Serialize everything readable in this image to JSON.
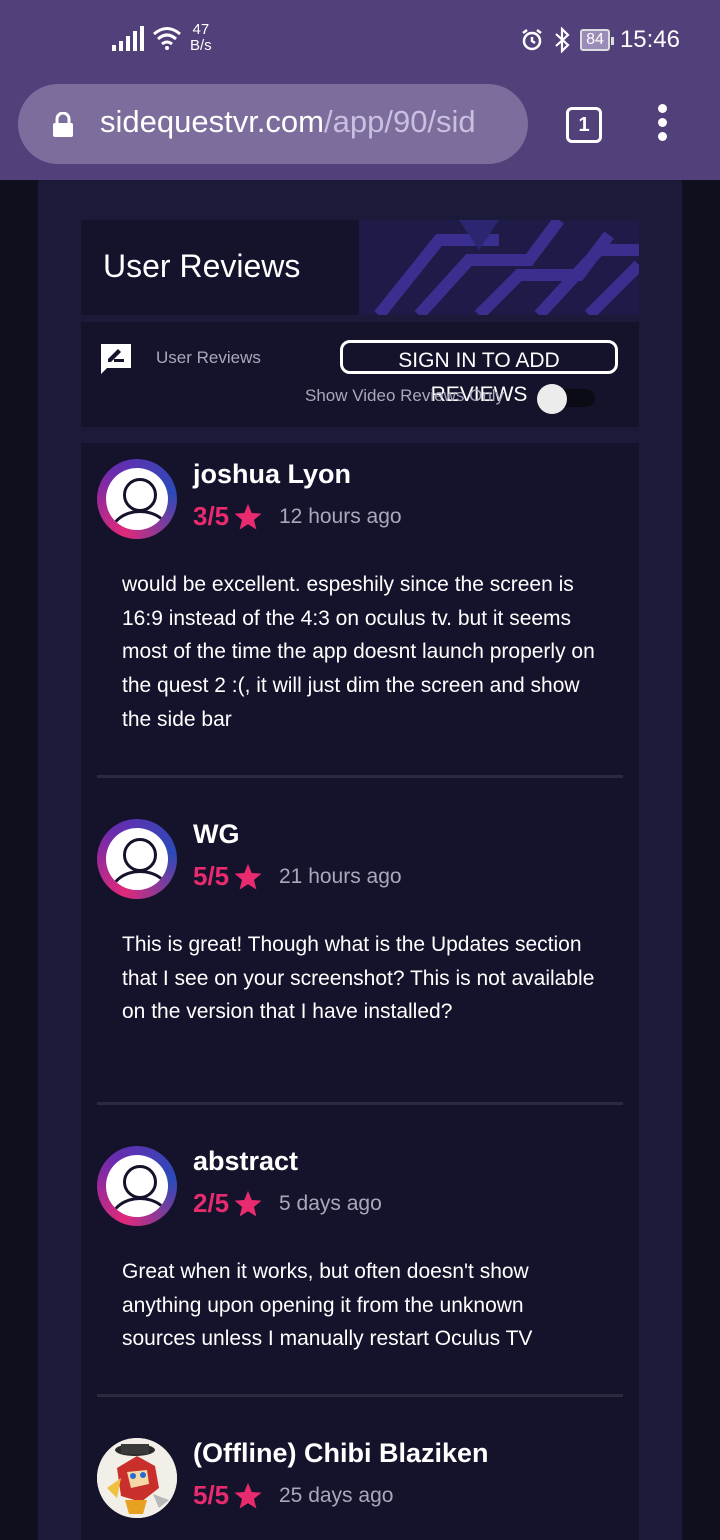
{
  "status_bar": {
    "net_speed_value": "47",
    "net_speed_unit": "B/s",
    "battery": "84",
    "time": "15:46"
  },
  "browser": {
    "url_host": "sidequestvr.com",
    "url_path": "/app/90/sid",
    "tab_count": "1"
  },
  "section": {
    "title": "User Reviews",
    "filter_label": "User Reviews",
    "signin_label": "SIGN IN TO ADD REVIEWS",
    "video_only_label": "Show Video Reviews Only",
    "video_only_on": false
  },
  "colors": {
    "accent": "#e82a6e",
    "chrome": "#51407a",
    "card": "#14132b"
  },
  "reviews": [
    {
      "name": "joshua Lyon",
      "rating": "3/5",
      "time": "12 hours ago",
      "text": "would be excellent. espeshily since the screen is 16:9 instead of the 4:3 on oculus tv. but it seems most of the time the app doesnt launch properly on the quest 2 :(, it will just dim the screen and show the side bar",
      "avatar": "default-user-icon"
    },
    {
      "name": "WG",
      "rating": "5/5",
      "time": "21 hours ago",
      "text": "This is great! Though what is the Updates section that I see on your screenshot? This is not available on the version that I have installed?",
      "avatar": "default-user-icon"
    },
    {
      "name": "abstract",
      "rating": "2/5",
      "time": "5 days ago",
      "text": "Great when it works, but often doesn't show anything upon opening it from the unknown sources unless I manually restart Oculus TV",
      "avatar": "default-user-icon"
    },
    {
      "name": "(Offline) Chibi Blaziken",
      "rating": "5/5",
      "time": "25 days ago",
      "text": "",
      "avatar": "custom-avatar-image"
    }
  ]
}
